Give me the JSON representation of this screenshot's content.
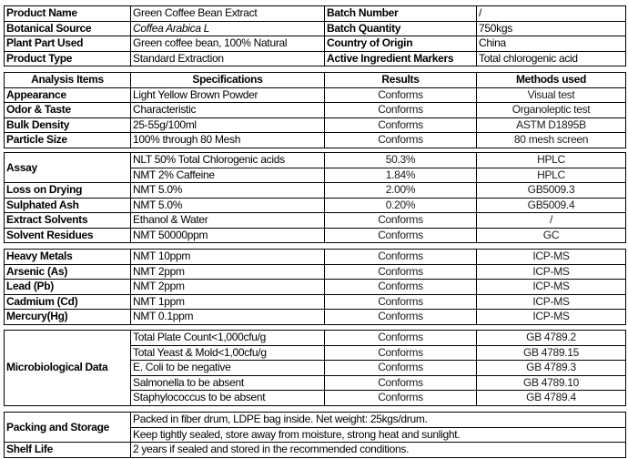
{
  "product_info": [
    {
      "label": "Product Name",
      "value": "Green Coffee Bean Extract",
      "label2": "Batch Number",
      "value2": "/"
    },
    {
      "label": "Botanical Source",
      "value": "Coffea Arabica L",
      "label2": "Batch Quantity",
      "value2": "750kgs"
    },
    {
      "label": "Plant Part Used",
      "value": "Green coffee bean, 100% Natural",
      "label2": "Country of Origin",
      "value2": "China"
    },
    {
      "label": "Product Type",
      "value": "Standard Extraction",
      "label2": "Active Ingredient Markers",
      "value2": "Total chlorogenic acid"
    }
  ],
  "headers": {
    "item": "Analysis Items",
    "spec": "Specifications",
    "result": "Results",
    "method": "Methods used"
  },
  "physical": [
    {
      "item": "Appearance",
      "spec": "Light Yellow Brown Powder",
      "result": "Conforms",
      "method": "Visual test"
    },
    {
      "item": "Odor & Taste",
      "spec": "Characteristic",
      "result": "Conforms",
      "method": "Organoleptic test"
    },
    {
      "item": "Bulk Density",
      "spec": "25-55g/100ml",
      "result": "Conforms",
      "method": "ASTM D1895B"
    },
    {
      "item": "Particle Size",
      "spec": "100% through 80 Mesh",
      "result": "Conforms",
      "method": "80 mesh screen"
    }
  ],
  "assay": {
    "item": "Assay",
    "rows": [
      {
        "spec": "NLT 50% Total Chlorogenic acids",
        "result": "50.3%",
        "method": "HPLC"
      },
      {
        "spec": "NMT 2% Caffeine",
        "result": "1.84%",
        "method": "HPLC"
      }
    ]
  },
  "chemical": [
    {
      "item": "Loss on Drying",
      "spec": "NMT 5.0%",
      "result": "2.00%",
      "method": "GB5009.3"
    },
    {
      "item": "Sulphated Ash",
      "spec": "NMT 5.0%",
      "result": "0.20%",
      "method": "GB5009.4"
    },
    {
      "item": "Extract Solvents",
      "spec": "Ethanol & Water",
      "result": "Conforms",
      "method": "/"
    },
    {
      "item": "Solvent Residues",
      "spec": "NMT 50000ppm",
      "result": "Conforms",
      "method": "GC"
    }
  ],
  "metals": [
    {
      "item": "Heavy Metals",
      "spec": "NMT 10ppm",
      "result": "Conforms",
      "method": "ICP-MS"
    },
    {
      "item": "Arsenic (As)",
      "spec": "NMT 2ppm",
      "result": "Conforms",
      "method": "ICP-MS"
    },
    {
      "item": "Lead (Pb)",
      "spec": "NMT 2ppm",
      "result": "Conforms",
      "method": "ICP-MS"
    },
    {
      "item": "Cadmium (Cd)",
      "spec": "NMT 1ppm",
      "result": "Conforms",
      "method": "ICP-MS"
    },
    {
      "item": "Mercury(Hg)",
      "spec": "NMT 0.1ppm",
      "result": "Conforms",
      "method": "ICP-MS"
    }
  ],
  "micro": {
    "item": "Microbiological Data",
    "rows": [
      {
        "spec": "Total Plate Count<1,000cfu/g",
        "result": "Conforms",
        "method": "GB 4789.2"
      },
      {
        "spec": "Total Yeast & Mold<1,00cfu/g",
        "result": "Conforms",
        "method": "GB 4789.15"
      },
      {
        "spec": "E. Coli to be negative",
        "result": "Conforms",
        "method": "GB 4789.3"
      },
      {
        "spec": "Salmonella to be absent",
        "result": "Conforms",
        "method": "GB 4789.10"
      },
      {
        "spec": "Staphylococcus to be absent",
        "result": "Conforms",
        "method": "GB 4789.4"
      }
    ]
  },
  "packing": {
    "item": "Packing and Storage",
    "lines": [
      "Packed in fiber drum, LDPE bag inside. Net weight: 25kgs/drum.",
      "Keep tightly sealed, store away from moisture, strong heat and sunlight."
    ]
  },
  "shelf_life": {
    "item": "Shelf Life",
    "value": "2 years if sealed and stored in the recommended conditions."
  }
}
